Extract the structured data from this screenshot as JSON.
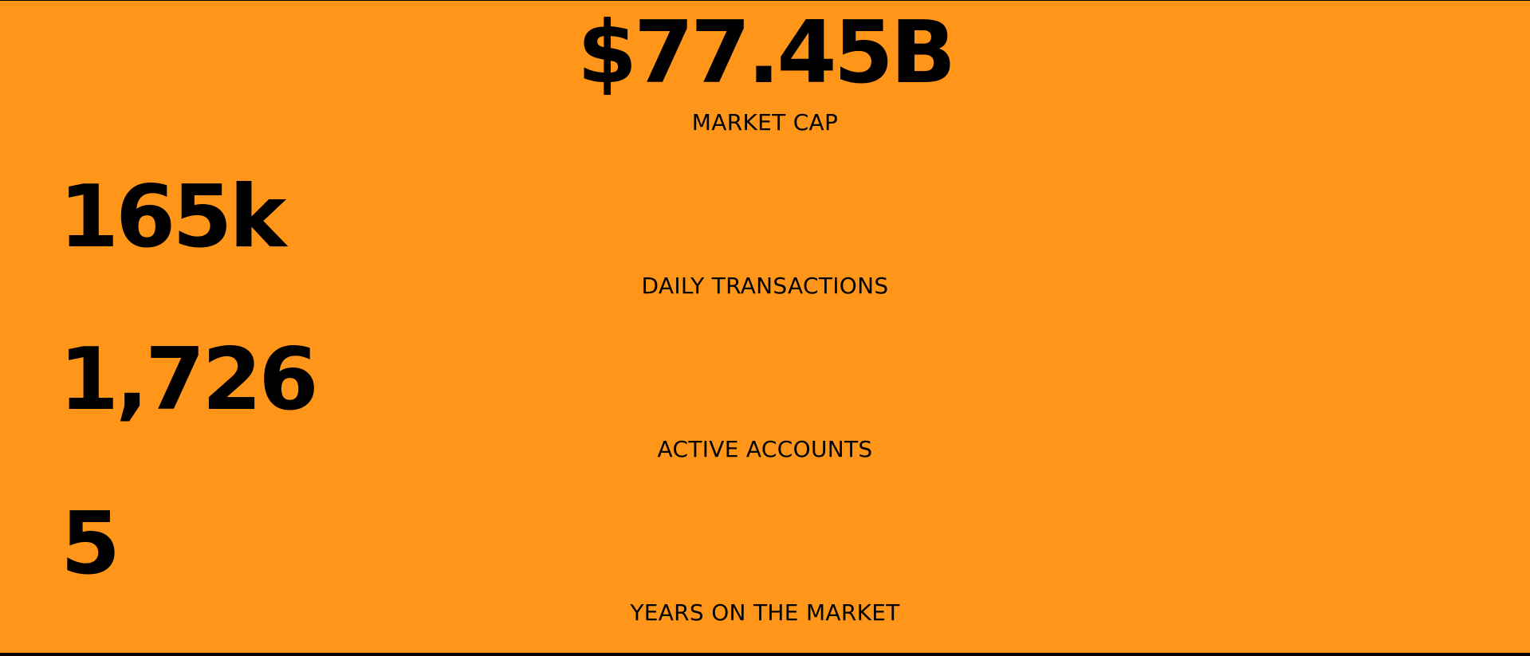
{
  "theme": {
    "background": "#ff961a",
    "frame": "#000000",
    "text": "#000000"
  },
  "stats": [
    {
      "value": "$77.45B",
      "label": "MARKET CAP"
    },
    {
      "value": "165k",
      "label": "DAILY TRANSACTIONS"
    },
    {
      "value": "1,726",
      "label": "ACTIVE ACCOUNTS"
    },
    {
      "value": "5",
      "label": "YEARS ON THE MARKET"
    }
  ]
}
